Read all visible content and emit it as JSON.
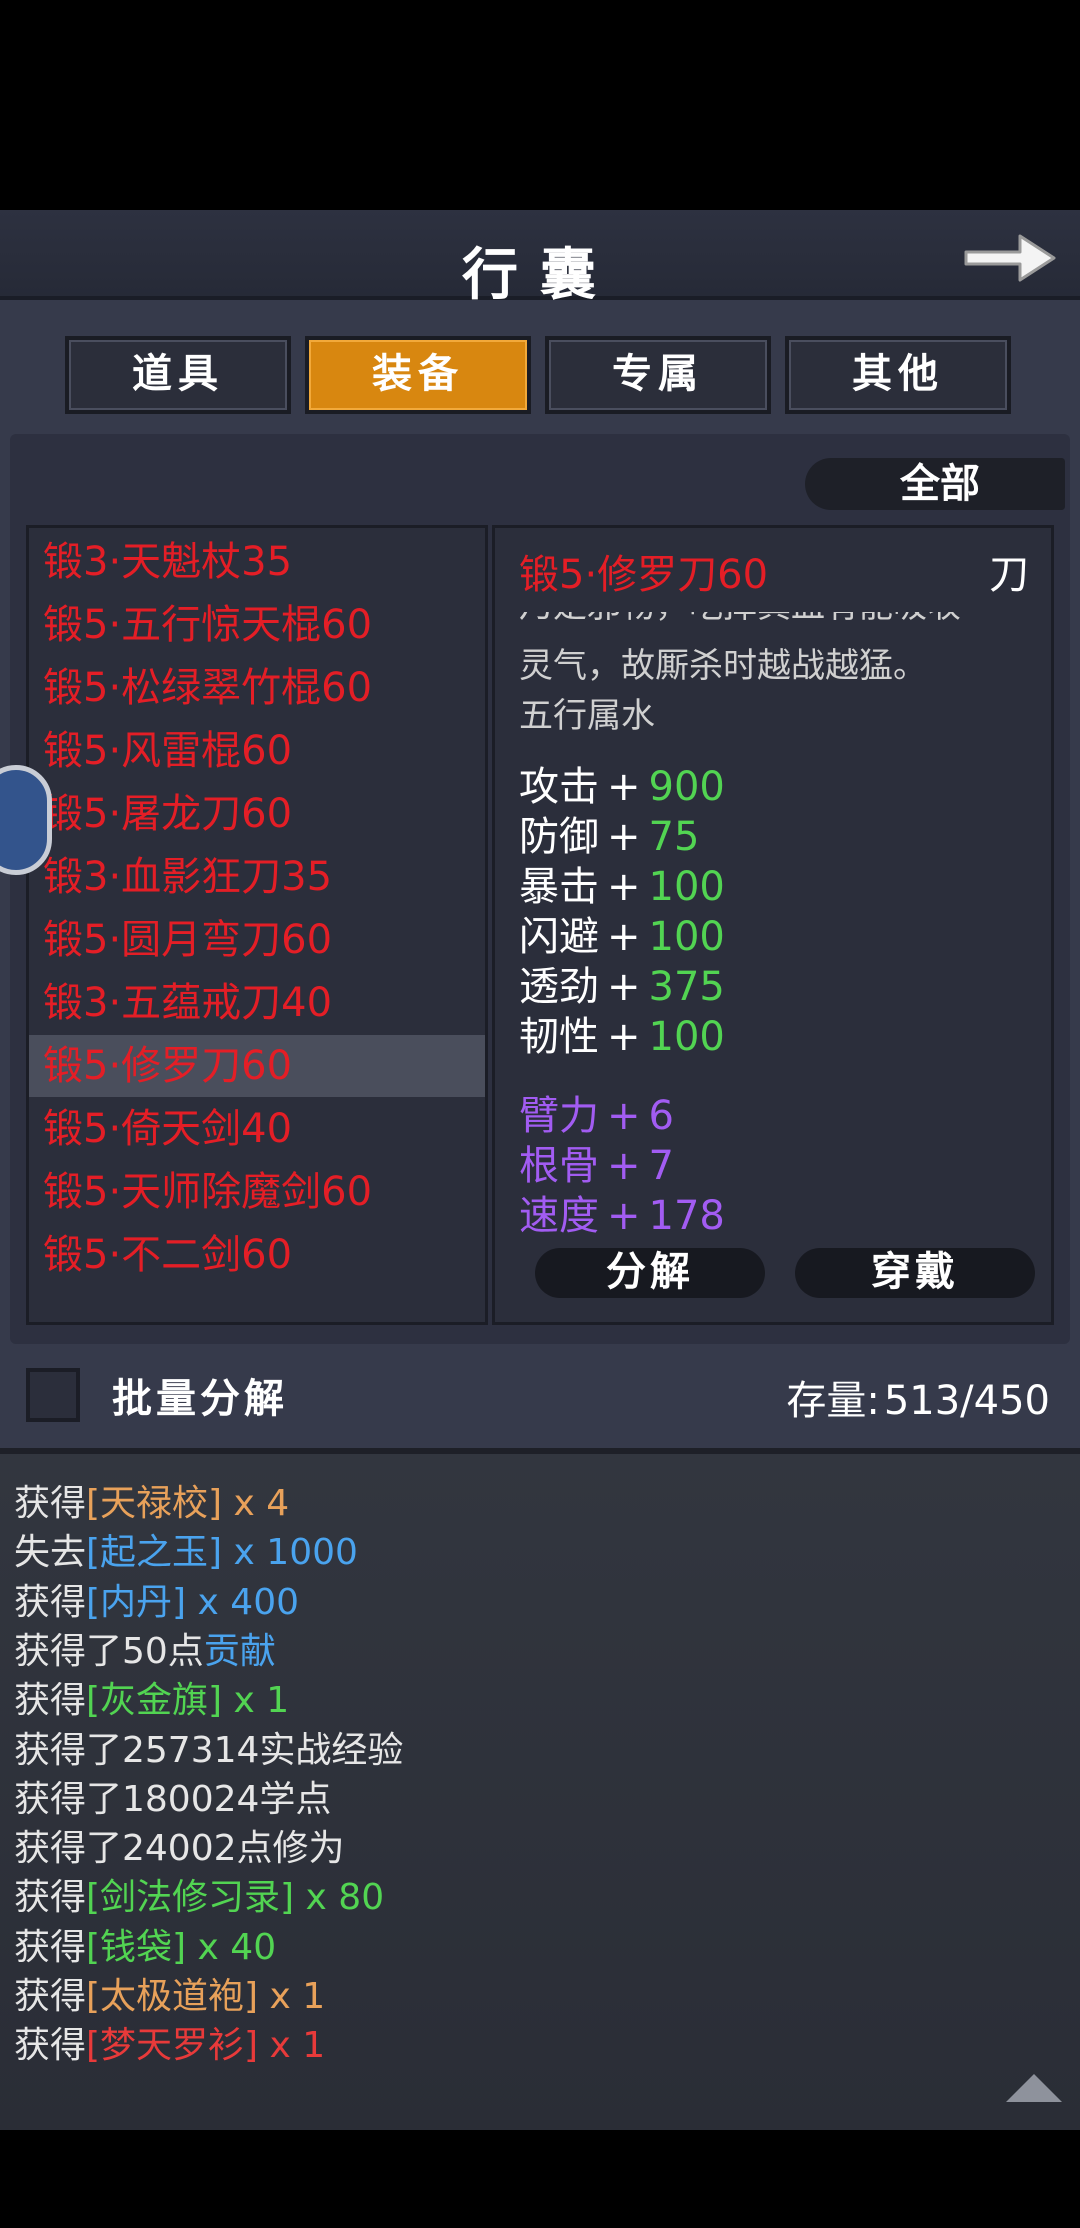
{
  "header": {
    "title": "行囊"
  },
  "tabs": [
    "道具",
    "装备",
    "专属",
    "其他"
  ],
  "active_tab": "装备",
  "filter": {
    "label": "全部"
  },
  "items": [
    "锻3·天魁杖35",
    "锻5·五行惊天棍60",
    "锻5·松绿翠竹棍60",
    "锻5·风雷棍60",
    "锻5·屠龙刀60",
    "锻3·血影狂刀35",
    "锻5·圆月弯刀60",
    "锻3·五蕴戒刀40",
    "锻5·修罗刀60",
    "锻5·倚天剑40",
    "锻5·天师除魔剑60",
    "锻5·不二剑60"
  ],
  "selected_item": "锻5·修罗刀60",
  "detail": {
    "name": "锻5·修罗刀60",
    "type": "刀",
    "desc_cut": "乃是邪物，吃掉真血有能吸收",
    "desc_line": "灵气，故厮杀时越战越猛。",
    "element": "五行属水",
    "stats": [
      {
        "label": "攻击",
        "plus": "+",
        "value": "900"
      },
      {
        "label": "防御",
        "plus": "+",
        "value": "75"
      },
      {
        "label": "暴击",
        "plus": "+",
        "value": "100"
      },
      {
        "label": "闪避",
        "plus": "+",
        "value": "100"
      },
      {
        "label": "透劲",
        "plus": "+",
        "value": "375"
      },
      {
        "label": "韧性",
        "plus": "+",
        "value": "100"
      }
    ],
    "attrs": [
      {
        "label": "臂力",
        "plus": "+",
        "value": "6"
      },
      {
        "label": "根骨",
        "plus": "+",
        "value": "7"
      },
      {
        "label": "速度",
        "plus": "+",
        "value": "178"
      }
    ],
    "decompose_label": "分解",
    "equip_label": "穿戴"
  },
  "batch": {
    "label": "批量分解"
  },
  "capacity": {
    "label": "存量:",
    "value": "513/450"
  },
  "log": [
    {
      "parts": [
        {
          "t": "获得"
        },
        {
          "t": "[天禄校]",
          "c": "#e8a15a"
        },
        {
          "t": " x 4",
          "c": "#e8a15a"
        }
      ]
    },
    {
      "parts": [
        {
          "t": "失去"
        },
        {
          "t": "[起之玉]",
          "c": "#4aa3ee"
        },
        {
          "t": " x 1000",
          "c": "#4aa3ee"
        }
      ]
    },
    {
      "parts": [
        {
          "t": "获得"
        },
        {
          "t": "[内丹]",
          "c": "#4aa3ee"
        },
        {
          "t": " x 400",
          "c": "#4aa3ee"
        }
      ]
    },
    {
      "parts": [
        {
          "t": "获得了50点"
        },
        {
          "t": "贡献",
          "c": "#4aa3ee"
        }
      ]
    },
    {
      "parts": [
        {
          "t": "获得"
        },
        {
          "t": "[灰金旗]",
          "c": "#52d452"
        },
        {
          "t": " x 1",
          "c": "#52d452"
        }
      ]
    },
    {
      "parts": [
        {
          "t": "获得了257314实战经验"
        }
      ]
    },
    {
      "parts": [
        {
          "t": "获得了180024学点"
        }
      ]
    },
    {
      "parts": [
        {
          "t": "获得了24002点修为"
        }
      ]
    },
    {
      "parts": [
        {
          "t": "获得"
        },
        {
          "t": "[剑法修习录]",
          "c": "#52d452"
        },
        {
          "t": " x 80",
          "c": "#52d452"
        }
      ]
    },
    {
      "parts": [
        {
          "t": "获得"
        },
        {
          "t": "[钱袋]",
          "c": "#52d452"
        },
        {
          "t": " x 40",
          "c": "#52d452"
        }
      ]
    },
    {
      "parts": [
        {
          "t": "获得"
        },
        {
          "t": "[太极道袍]",
          "c": "#e8a15a"
        },
        {
          "t": " x 1",
          "c": "#e8a15a"
        }
      ]
    },
    {
      "parts": [
        {
          "t": "获得"
        },
        {
          "t": "[梦天罗衫]",
          "c": "#e83a3a"
        },
        {
          "t": " x 1",
          "c": "#e83a3a"
        }
      ]
    }
  ],
  "colors": {
    "active_tab": "#d88710",
    "item_red": "#e41e26",
    "stat_green": "#52d452",
    "attr_purple": "#a25cf2"
  }
}
